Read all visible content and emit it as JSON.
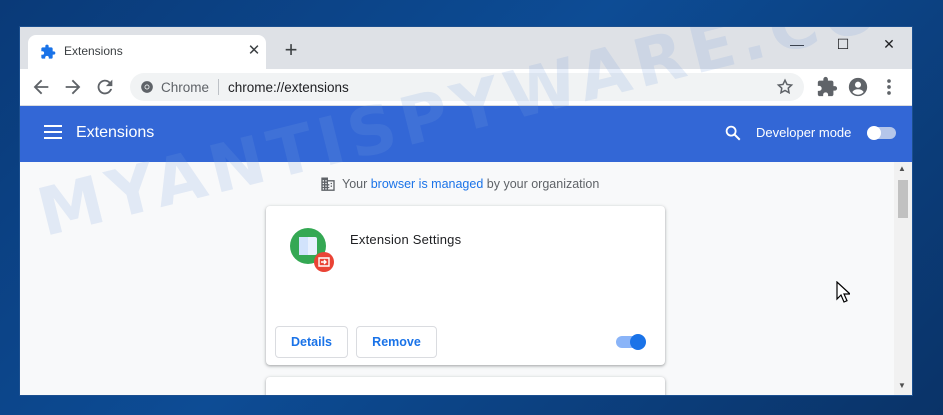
{
  "tab": {
    "title": "Extensions",
    "close_glyph": "✕",
    "new_tab_glyph": "+"
  },
  "window_controls": {
    "minimize": "—",
    "maximize": "☐",
    "close": "✕"
  },
  "omnibox": {
    "site_label": "Chrome",
    "url": "chrome://extensions"
  },
  "header": {
    "title": "Extensions",
    "developer_mode_label": "Developer mode",
    "developer_mode_on": false
  },
  "managed_notice": {
    "prefix": "Your ",
    "link": "browser is managed",
    "suffix": " by your organization"
  },
  "extensions": [
    {
      "name": "Extension Settings",
      "details_label": "Details",
      "remove_label": "Remove",
      "enabled": true
    }
  ],
  "watermark": "MYANTISPYWARE.COM",
  "colors": {
    "accent": "#3367d6",
    "link": "#1a73e8",
    "toggle_on": "#1a73e8"
  },
  "icons": [
    "extensions-puzzle-icon",
    "close-icon",
    "plus-icon",
    "back-arrow-icon",
    "forward-arrow-icon",
    "reload-icon",
    "chrome-icon",
    "star-icon",
    "puzzle-icon",
    "profile-icon",
    "more-vert-icon",
    "hamburger-menu-icon",
    "search-icon",
    "building-icon",
    "cursor-icon"
  ]
}
